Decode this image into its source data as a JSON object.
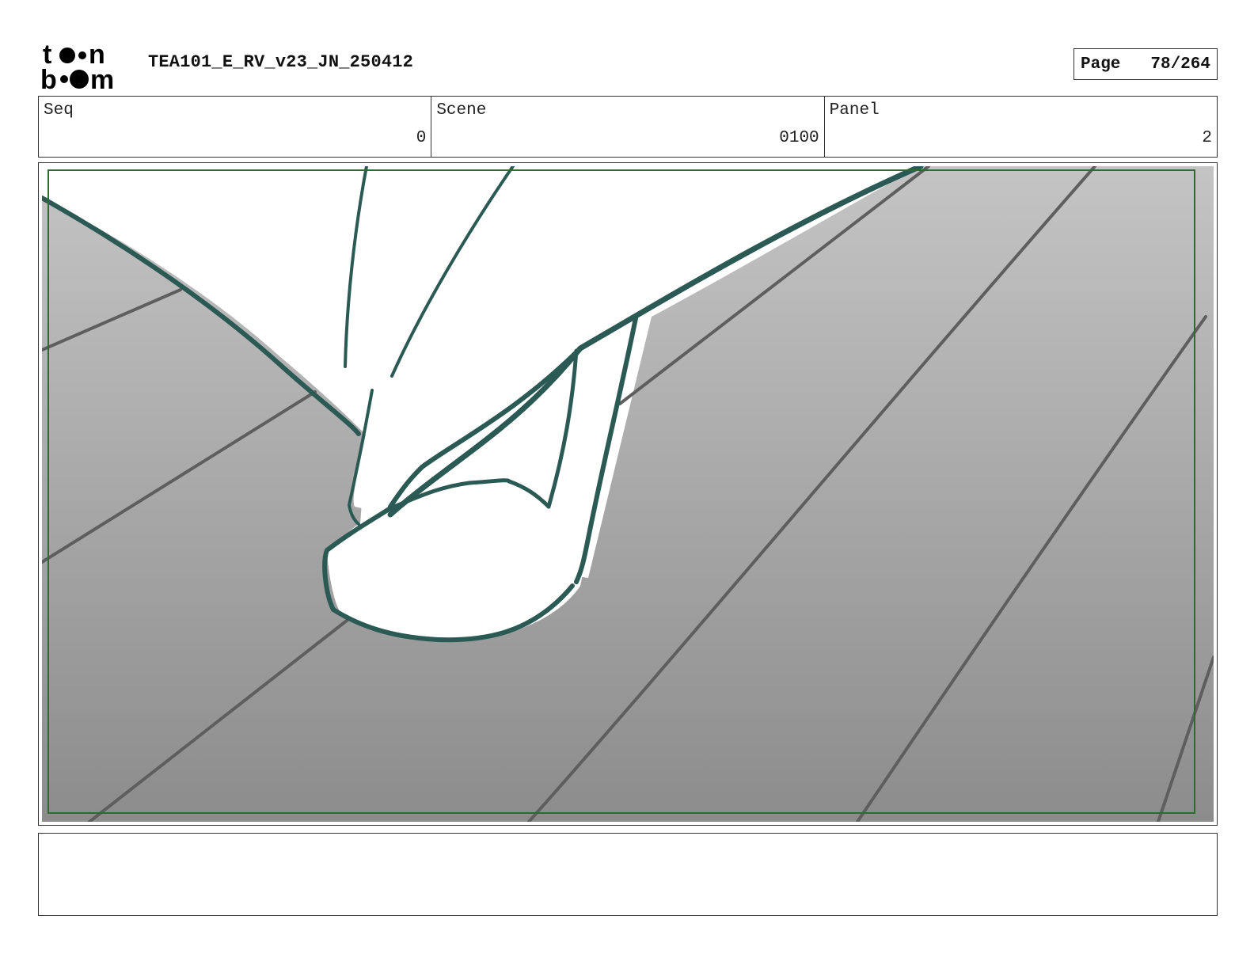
{
  "header": {
    "logo_text": "toon boom",
    "logo_icon": "toon-boom-logo",
    "title": "TEA101_E_RV_v23_JN_250412",
    "page_label": "Page",
    "page_value": "78/264"
  },
  "info": {
    "seq_label": "Seq",
    "seq_value": "0",
    "scene_label": "Scene",
    "scene_value": "0100",
    "panel_label": "Panel",
    "panel_value": "2"
  },
  "panel_image": {
    "icon": "storyboard-sketch-foot-on-floorboards",
    "colors": {
      "ink": "#2b5954",
      "floor_top": "#c4c4c4",
      "floor_bottom": "#8c8c8c",
      "board_lines": "#5e5e5e",
      "safe_frame": "#2e6b2e"
    }
  },
  "notes": {
    "text": ""
  }
}
